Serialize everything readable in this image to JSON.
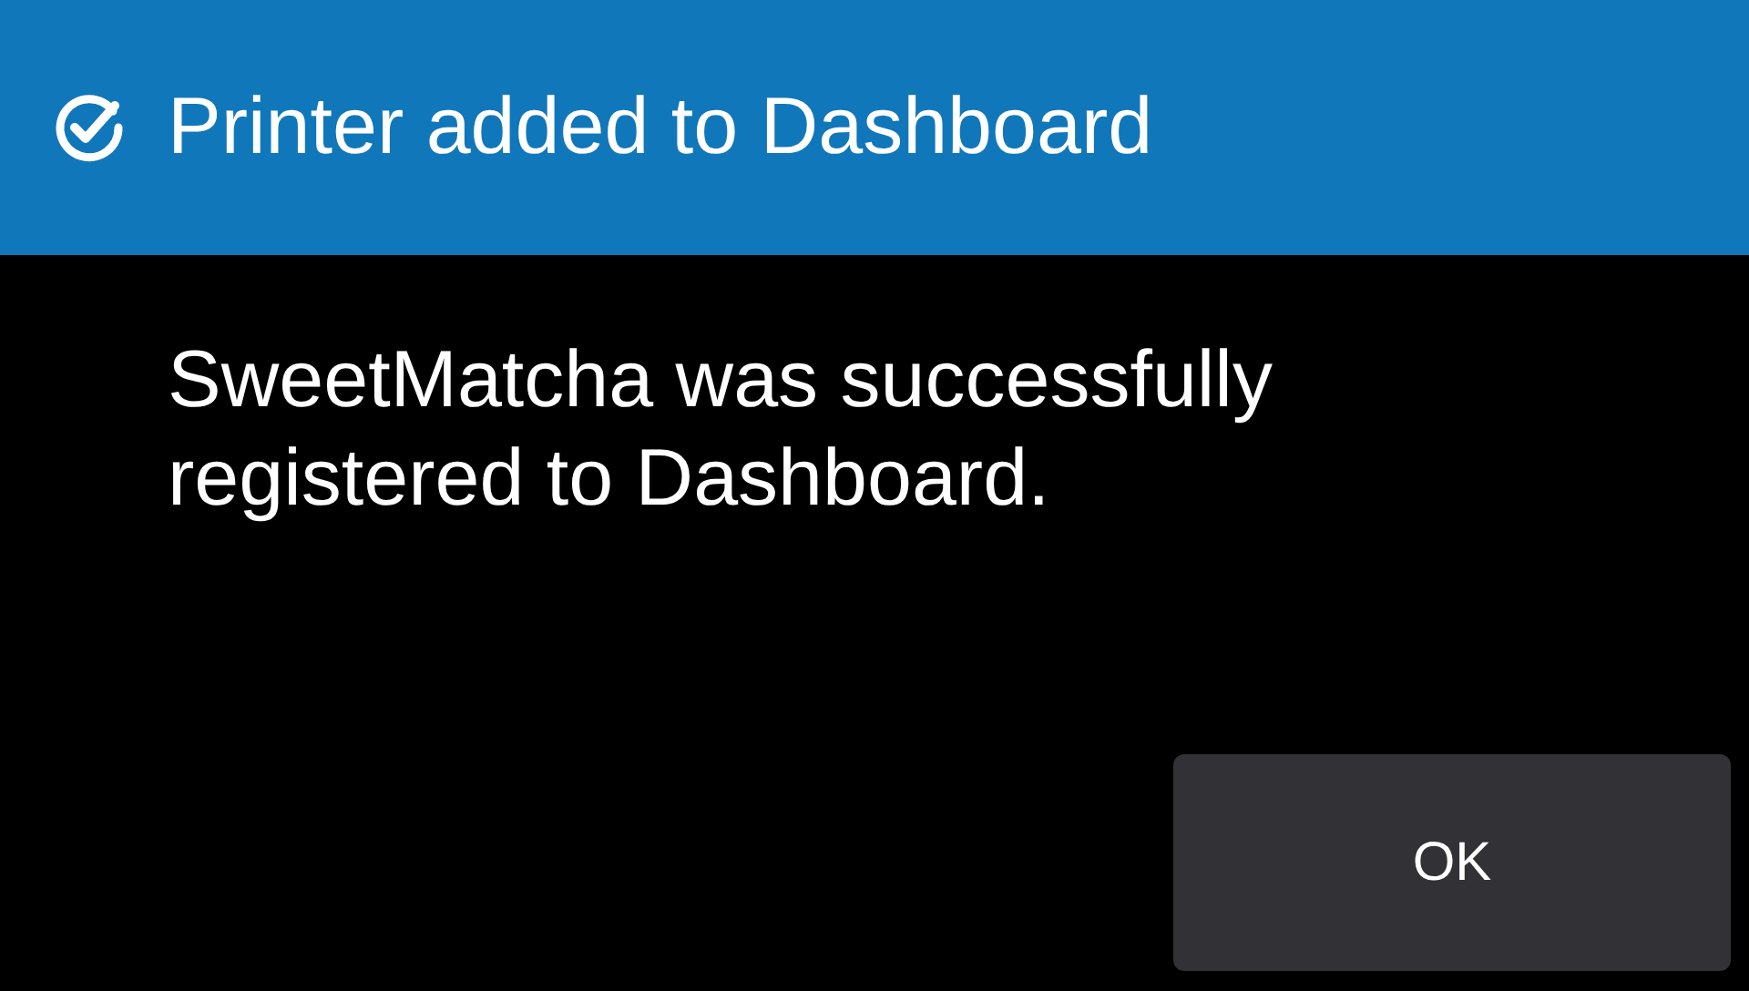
{
  "header": {
    "title": "Printer added to Dashboard"
  },
  "message": "SweetMatcha was successfully registered to Dashboard.",
  "buttons": [
    {
      "label": "OK",
      "kind": "primary"
    }
  ]
}
